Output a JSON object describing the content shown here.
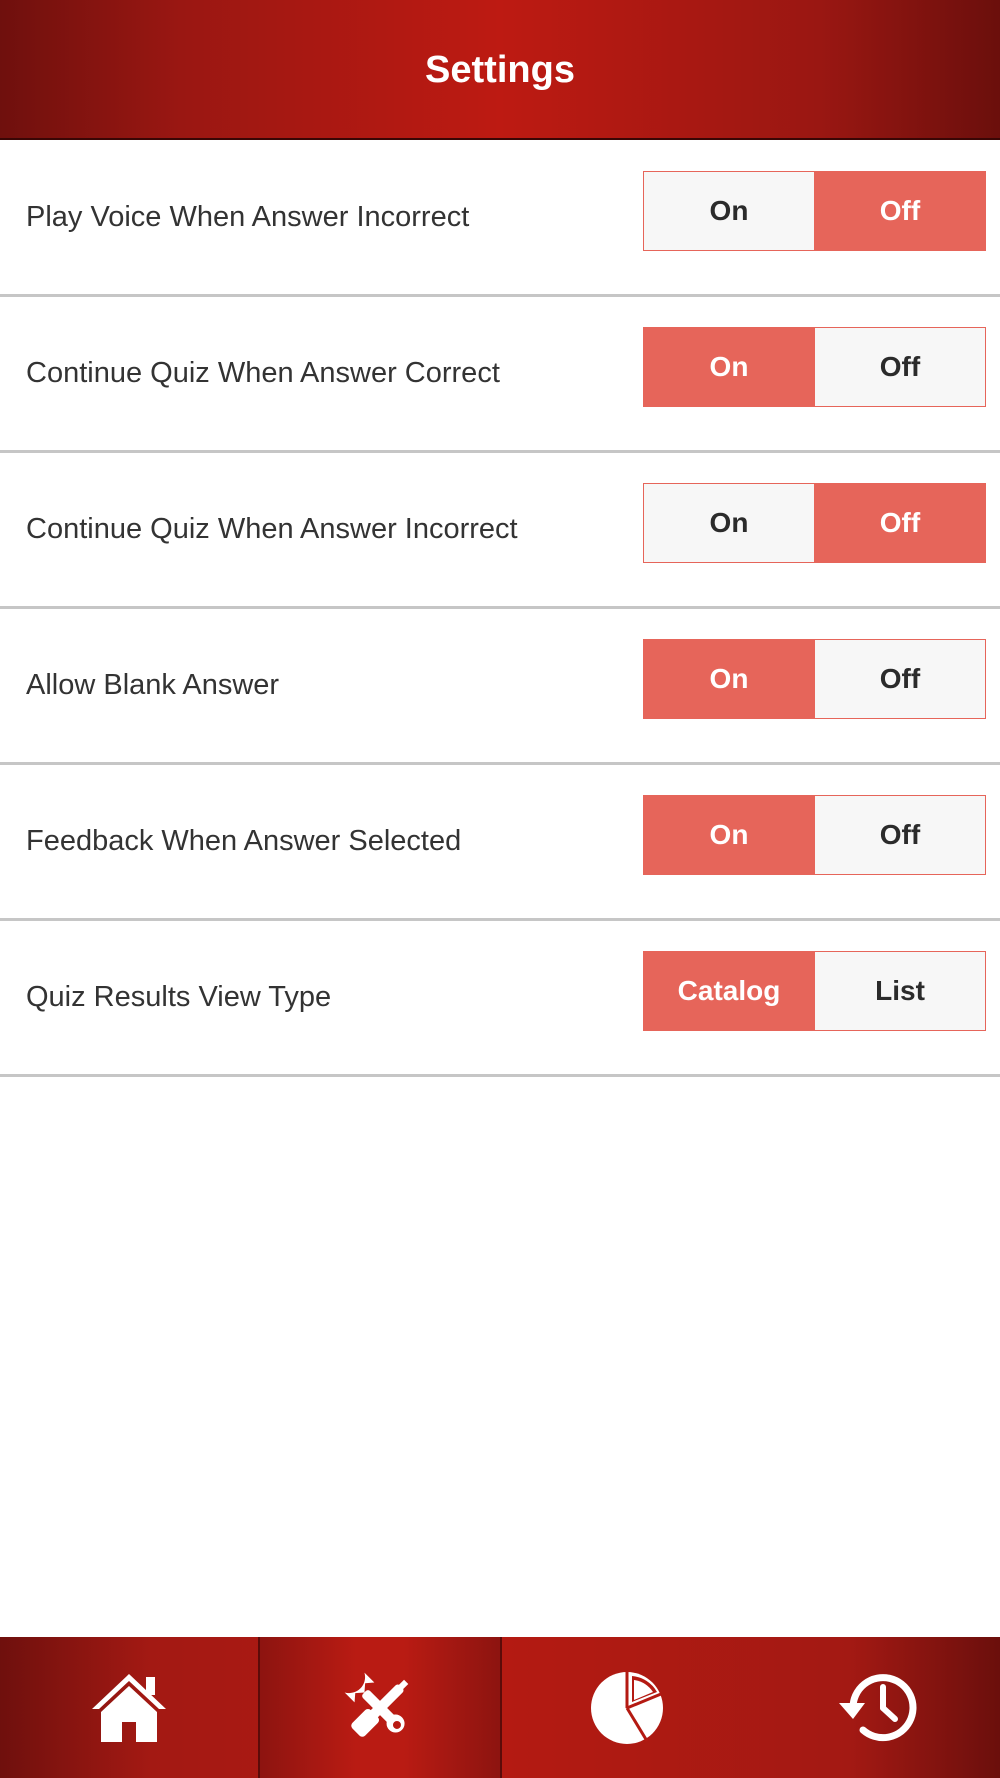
{
  "header": {
    "title": "Settings"
  },
  "settings": [
    {
      "label": "Play Voice When Answer Incorrect",
      "options": [
        "On",
        "Off"
      ],
      "selected": "Off"
    },
    {
      "label": "Continue Quiz When Answer Correct",
      "options": [
        "On",
        "Off"
      ],
      "selected": "On"
    },
    {
      "label": "Continue Quiz When Answer Incorrect",
      "options": [
        "On",
        "Off"
      ],
      "selected": "Off"
    },
    {
      "label": "Allow Blank Answer",
      "options": [
        "On",
        "Off"
      ],
      "selected": "On"
    },
    {
      "label": "Feedback When Answer Selected",
      "options": [
        "On",
        "Off"
      ],
      "selected": "On"
    },
    {
      "label": "Quiz Results View Type",
      "options": [
        "Catalog",
        "List"
      ],
      "selected": "Catalog"
    }
  ],
  "tabbar": {
    "items": [
      {
        "icon": "home-icon",
        "active": false
      },
      {
        "icon": "tools-icon",
        "active": true
      },
      {
        "icon": "pie-chart-icon",
        "active": false
      },
      {
        "icon": "history-icon",
        "active": false
      }
    ]
  },
  "colors": {
    "header_red": "#b41a12",
    "accent_selected": "#e6655a",
    "divider": "#c6c6c6"
  }
}
